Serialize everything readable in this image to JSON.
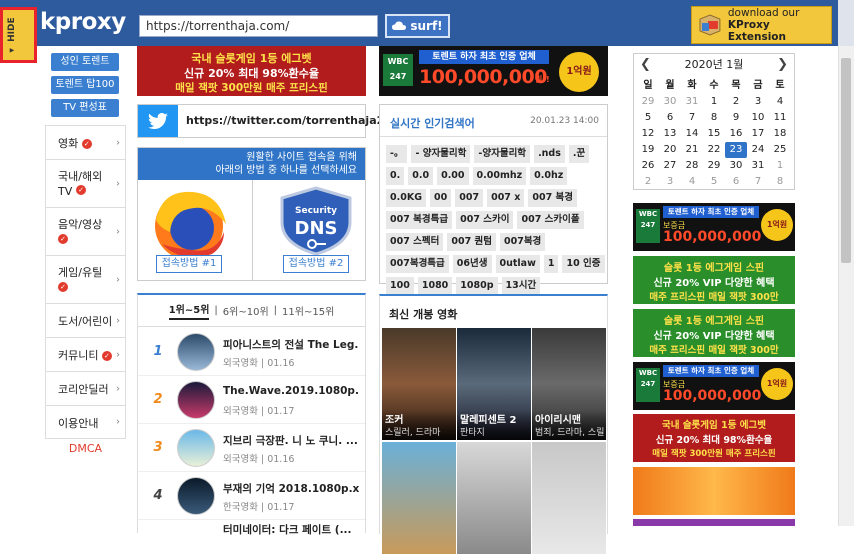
{
  "proxy_bar": {
    "hide_label": "HIDE",
    "logo_text": "kproxy",
    "url_value": "https://torrenthaja.com/",
    "surf_label": "surf!",
    "extension_line1": "download our",
    "extension_line2": "KProxy Extension"
  },
  "sidebar": {
    "pills": [
      "성인 토렌트",
      "토렌트 탑100",
      "TV 편성표"
    ],
    "menu": [
      {
        "label": "영화",
        "check": true
      },
      {
        "label": "국내/해외 TV",
        "check": true
      },
      {
        "label": "음악/영상",
        "check": true
      },
      {
        "label": "게임/유틸",
        "check": true
      },
      {
        "label": "도서/어린이",
        "check": false
      },
      {
        "label": "커뮤니티",
        "check": true
      },
      {
        "label": "코리안딜러",
        "check": false
      },
      {
        "label": "이용안내",
        "check": false
      }
    ],
    "dmca": "DMCA"
  },
  "banners": {
    "casino": {
      "line1": "국내 슬롯게임 1등 에그벳",
      "line2": "신규 20% 최대 98%환수율",
      "line3": "매일 잭팟 300만원 매주 프리스핀"
    },
    "wbc": {
      "brand": "WBC 247",
      "headline": "토렌트 하자 최초 인증 업체",
      "amount": "100,000,000",
      "won": "원!!",
      "badge": "1억원",
      "tag": "보증금"
    },
    "green": {
      "line1": "슬롯 1등 에그게임 스핀",
      "line2": "신규 20% VIP 다양한 혜택",
      "line3": "매주 프리스핀 매일 잭팟 300만"
    }
  },
  "twitter": {
    "link": "https://twitter.com/torrenthaja2"
  },
  "access": {
    "header_line1": "원활한 사이트 접속을 위해",
    "header_line2": "아래의 방법 중 하나를 선택하세요",
    "dns_line1": "Security",
    "dns_line2": "DNS",
    "btn1": "접속방법 #1",
    "btn2": "접속방법 #2"
  },
  "ranking": {
    "tabs": [
      "1위~5위",
      "6위~10위",
      "11위~15위"
    ],
    "items": [
      {
        "rank": "1",
        "title": "피아니스트의 전설 The Leg...",
        "category": "외국영화",
        "date": "01.16"
      },
      {
        "rank": "2",
        "title": "The.Wave.2019.1080p.AMZ...",
        "category": "외국영화",
        "date": "01.17"
      },
      {
        "rank": "3",
        "title": "지브리 극장판. 니 노 쿠니. ...",
        "category": "외국영화",
        "date": "01.16"
      },
      {
        "rank": "4",
        "title": "부재의 기억 2018.1080p.x264",
        "category": "한국영화",
        "date": "01.17"
      },
      {
        "rank": "5",
        "title": "터미네이터: 다크 페이트 (...",
        "category": "",
        "date": ""
      }
    ]
  },
  "keywords": {
    "title": "실시간 인기검색어",
    "date": "20.01.23 14:00",
    "tags": [
      "-。",
      "- 양자물리학",
      "-양자물리학",
      ".nds",
      ".꾼",
      "0.",
      "0.0",
      "0.00",
      "0.00mhz",
      "0.0hz",
      "0.0KG",
      "00",
      "007",
      "007 ⅹ",
      "007 복경",
      "007 복경특급",
      "007 스카이",
      "007 스카이폴",
      "007 스펙터",
      "007 퀀텀",
      "007복경",
      "007복경특급",
      "06년생",
      "0utlaw",
      "1",
      "10 인증",
      "100",
      "1080",
      "1080p",
      "13시간"
    ]
  },
  "movies": {
    "title": "최신 개봉 영화",
    "items": [
      {
        "name": "조커",
        "genre": "스릴러, 드라마"
      },
      {
        "name": "말레피센트 2",
        "genre": "판타지"
      },
      {
        "name": "아이리시맨",
        "genre": "범죄, 드라마, 스릴"
      },
      {
        "name": "",
        "genre": ""
      },
      {
        "name": "",
        "genre": ""
      },
      {
        "name": "",
        "genre": ""
      }
    ]
  },
  "calendar": {
    "title": "2020년 1월",
    "prev": "❮",
    "next": "❯",
    "weekdays": [
      "일",
      "월",
      "화",
      "수",
      "목",
      "금",
      "토"
    ],
    "days": [
      [
        "29",
        "30",
        "31",
        "1",
        "2",
        "3",
        "4"
      ],
      [
        "5",
        "6",
        "7",
        "8",
        "9",
        "10",
        "11"
      ],
      [
        "12",
        "13",
        "14",
        "15",
        "16",
        "17",
        "18"
      ],
      [
        "19",
        "20",
        "21",
        "22",
        "23",
        "24",
        "25"
      ],
      [
        "26",
        "27",
        "28",
        "29",
        "30",
        "31",
        "1"
      ],
      [
        "2",
        "3",
        "4",
        "5",
        "6",
        "7",
        "8"
      ]
    ],
    "today": "23"
  },
  "colors": {
    "proxy_blue": "#2e5a9e",
    "accent_blue": "#2f74c6",
    "hide_yellow": "#f3c73b",
    "alert_red": "#e23b2e"
  }
}
